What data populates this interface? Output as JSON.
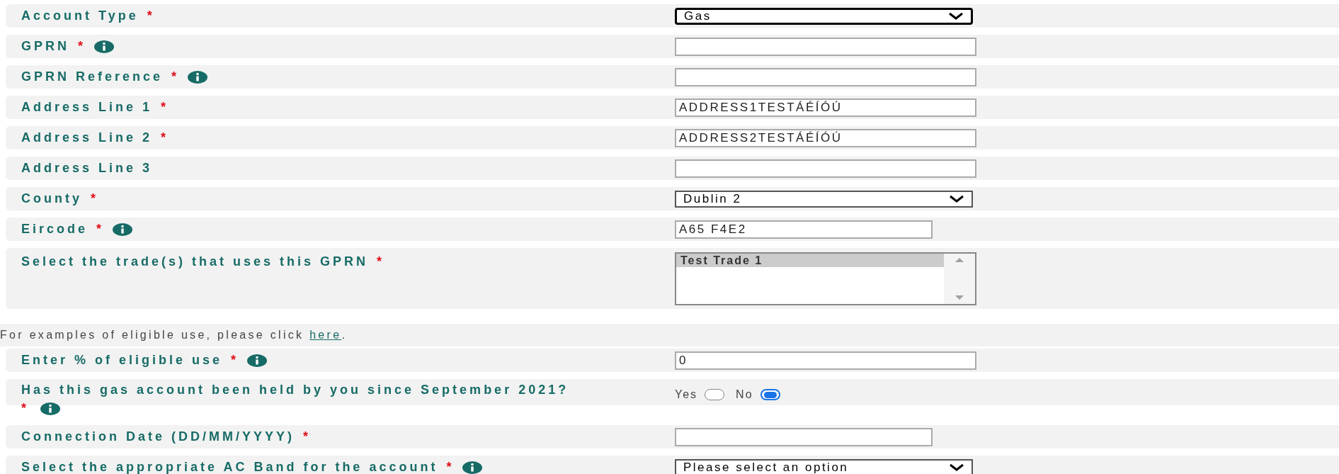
{
  "fields": [
    {
      "kind": "select",
      "label": "Account Type",
      "marker": "*",
      "info": false,
      "value": "Gas",
      "focused": true
    },
    {
      "kind": "text",
      "label": "GPRN",
      "marker": "*",
      "info": true
    },
    {
      "kind": "text",
      "label": "GPRN Reference",
      "marker": "*",
      "info": true
    },
    {
      "kind": "text",
      "label": "Address Line 1",
      "marker": "*",
      "info": false,
      "value": "ADDRESS1TESTÁÉÍÓÚ"
    },
    {
      "kind": "text",
      "label": "Address Line 2",
      "marker": "*",
      "info": false,
      "value": "ADDRESS2TESTÁÉÍÓÚ"
    },
    {
      "kind": "text",
      "label": "Address Line 3",
      "info": false
    },
    {
      "kind": "select",
      "label": "County",
      "marker": "*",
      "info": false,
      "value": "Dublin 2",
      "focused": false
    },
    {
      "kind": "short",
      "label": "Eircode",
      "marker": "*",
      "info": true,
      "value": "A65 F4E2"
    },
    {
      "kind": "list",
      "label": "Select the trade(s) that uses this GPRN",
      "marker": "*",
      "info": false,
      "options": [
        {
          "label": "Test Trade 1",
          "selected": true
        }
      ]
    },
    {
      "kind": "note",
      "text": "For examples of eligible use, please click ",
      "link": "here",
      "after": "."
    },
    {
      "kind": "text",
      "label": "Enter % of eligible use",
      "marker": "*",
      "info": true,
      "value": "0"
    },
    {
      "kind": "radio",
      "label": "Has this gas account been held by you since September 2021?",
      "marker": "*",
      "info": true,
      "options": [
        {
          "label": "Yes",
          "selected": false
        },
        {
          "label": "No",
          "selected": true
        }
      ]
    },
    {
      "kind": "short",
      "label": "Connection Date (DD/MM/YYYY)",
      "marker": "*",
      "info": false
    },
    {
      "kind": "select",
      "label": "Select the appropriate AC Band for the account",
      "marker": "*",
      "info": true,
      "value": "Please select an option",
      "focused": false
    }
  ]
}
